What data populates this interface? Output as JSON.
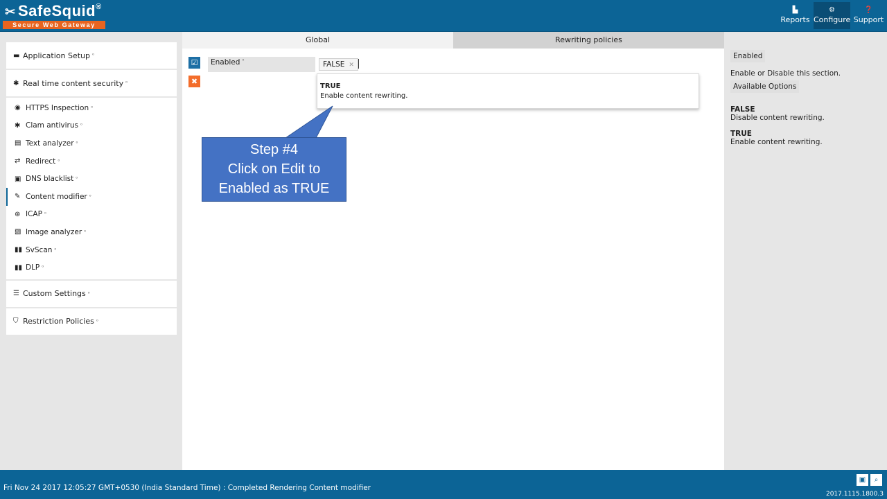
{
  "header": {
    "logo_text": "SafeSquid",
    "logo_reg": "®",
    "logo_subtitle": "Secure Web Gateway",
    "nav": [
      {
        "label": "Reports",
        "icon": "chart-icon"
      },
      {
        "label": "Configure",
        "icon": "gears-icon"
      },
      {
        "label": "Support",
        "icon": "question-icon"
      }
    ]
  },
  "sidebar": {
    "application_setup": "Application Setup",
    "real_time": "Real time content security",
    "items": [
      {
        "label": "HTTPS Inspection",
        "icon": "eye-icon"
      },
      {
        "label": "Clam antivirus",
        "icon": "asterisk-icon"
      },
      {
        "label": "Text analyzer",
        "icon": "document-icon"
      },
      {
        "label": "Redirect",
        "icon": "shuffle-icon"
      },
      {
        "label": "DNS blacklist",
        "icon": "dns-icon"
      },
      {
        "label": "Content modifier",
        "icon": "edit-icon"
      },
      {
        "label": "ICAP",
        "icon": "globe-icon"
      },
      {
        "label": "Image analyzer",
        "icon": "image-file-icon"
      },
      {
        "label": "SvScan",
        "icon": "columns-icon"
      },
      {
        "label": "DLP",
        "icon": "columns-icon"
      }
    ],
    "custom_settings": "Custom Settings",
    "restriction_policies": "Restriction Policies",
    "info_mark": "⁰"
  },
  "main": {
    "tabs": [
      "Global",
      "Rewriting policies"
    ],
    "field_label": "Enabled",
    "field_value": "FALSE",
    "dropdown": {
      "title": "TRUE",
      "desc": "Enable content rewriting."
    }
  },
  "callout": {
    "line1": "Step #4",
    "line2": "Click on Edit to",
    "line3": "Enabled as TRUE"
  },
  "help": {
    "field_chip": "Enabled",
    "field_desc": "Enable or Disable this section.",
    "options_chip": "Available Options",
    "options": [
      {
        "title": "FALSE",
        "desc": "Disable content rewriting."
      },
      {
        "title": "TRUE",
        "desc": "Enable content rewriting."
      }
    ]
  },
  "footer": {
    "status": "Fri Nov 24 2017 12:05:27 GMT+0530 (India Standard Time) : Completed Rendering Content modifier",
    "version": "2017.1115.1800.3"
  }
}
